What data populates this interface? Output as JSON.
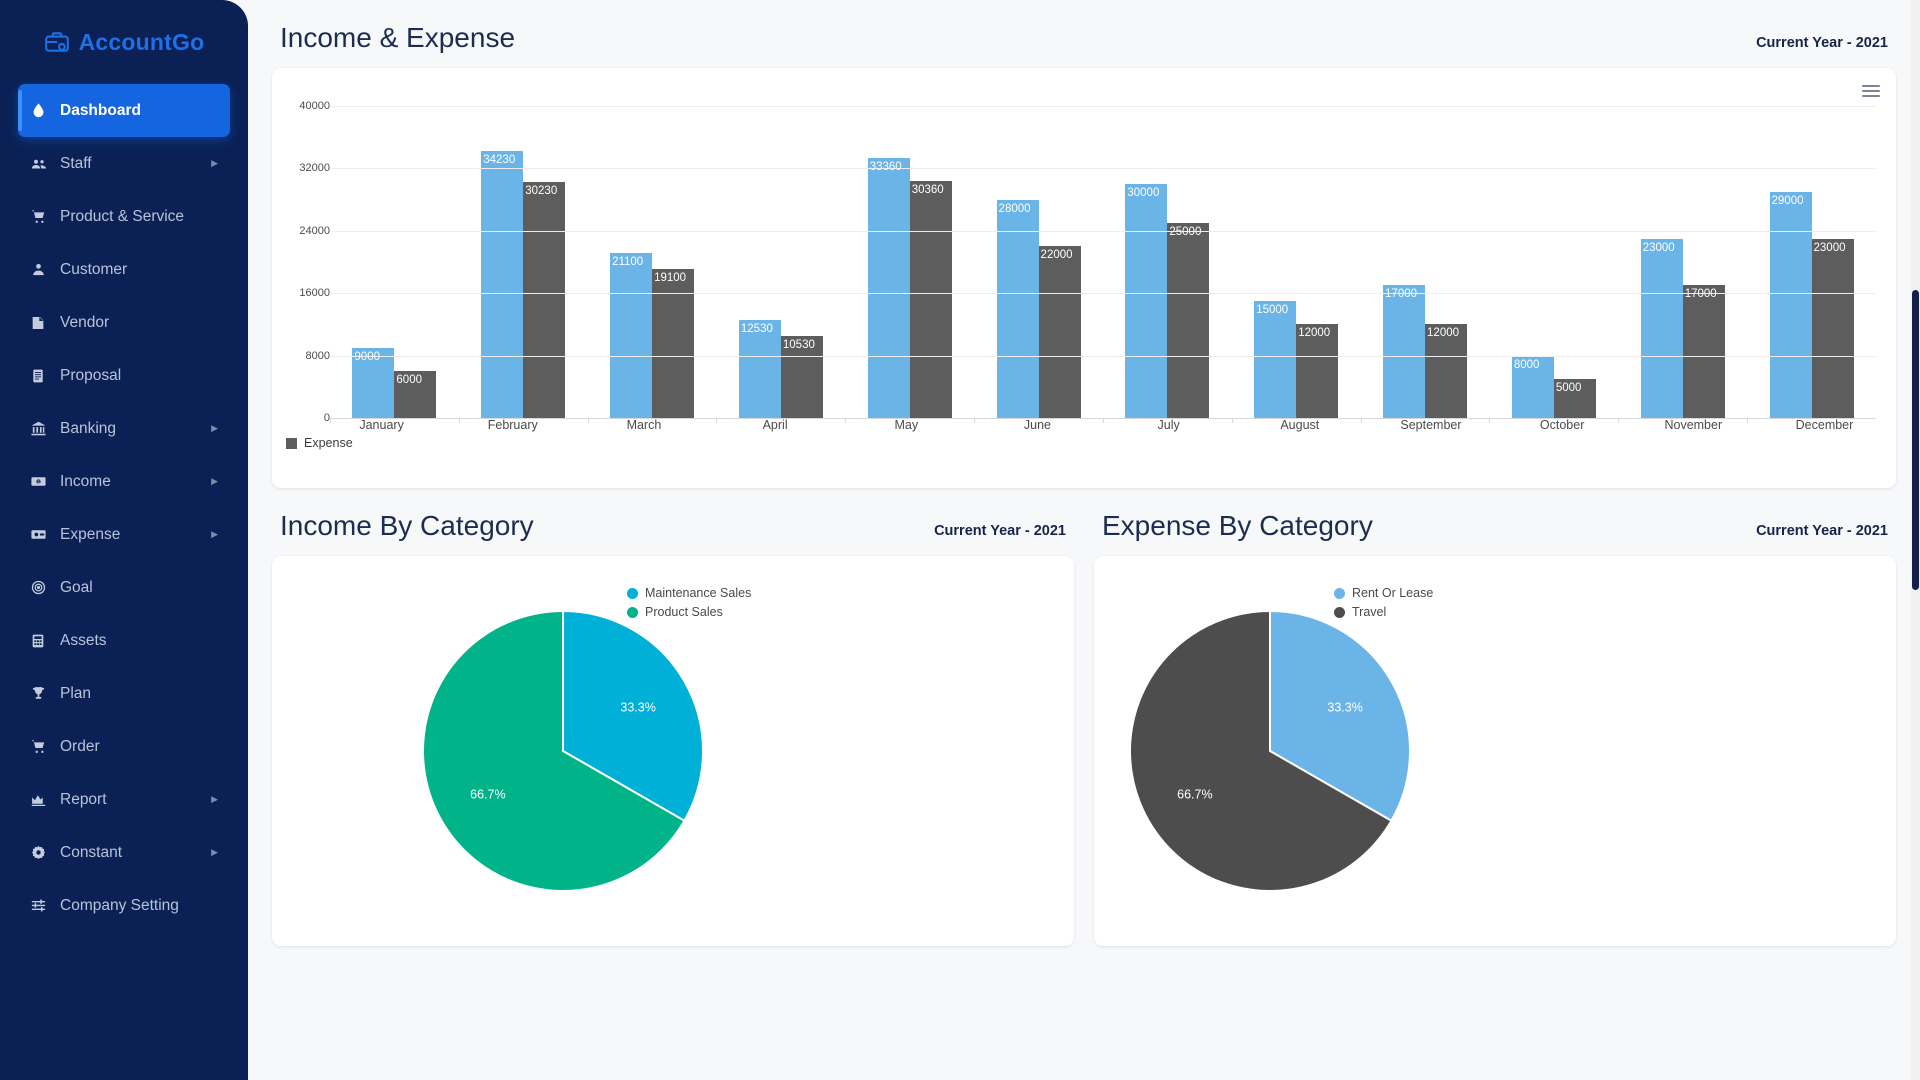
{
  "brand": {
    "name": "AccountGo",
    "logo_icon": "briefcase-logo-icon"
  },
  "sidebar": {
    "items": [
      {
        "label": "Dashboard",
        "icon": "droplet-icon",
        "active": true,
        "arrow": false
      },
      {
        "label": "Staff",
        "icon": "users-icon",
        "active": false,
        "arrow": true
      },
      {
        "label": "Product & Service",
        "icon": "cart-icon",
        "active": false,
        "arrow": false
      },
      {
        "label": "Customer",
        "icon": "user-badge-icon",
        "active": false,
        "arrow": false
      },
      {
        "label": "Vendor",
        "icon": "document-icon",
        "active": false,
        "arrow": false
      },
      {
        "label": "Proposal",
        "icon": "receipt-icon",
        "active": false,
        "arrow": false
      },
      {
        "label": "Banking",
        "icon": "bank-icon",
        "active": false,
        "arrow": true
      },
      {
        "label": "Income",
        "icon": "banknote-icon",
        "active": false,
        "arrow": true
      },
      {
        "label": "Expense",
        "icon": "money-card-icon",
        "active": false,
        "arrow": true
      },
      {
        "label": "Goal",
        "icon": "target-icon",
        "active": false,
        "arrow": false
      },
      {
        "label": "Assets",
        "icon": "calculator-icon",
        "active": false,
        "arrow": false
      },
      {
        "label": "Plan",
        "icon": "trophy-icon",
        "active": false,
        "arrow": false
      },
      {
        "label": "Order",
        "icon": "cart-icon",
        "active": false,
        "arrow": false
      },
      {
        "label": "Report",
        "icon": "chart-icon",
        "active": false,
        "arrow": true
      },
      {
        "label": "Constant",
        "icon": "gear-icon",
        "active": false,
        "arrow": true
      },
      {
        "label": "Company Setting",
        "icon": "sliders-icon",
        "active": false,
        "arrow": false
      }
    ]
  },
  "sections": {
    "income_expense": {
      "title": "Income & Expense",
      "subtitle": "Current Year - 2021",
      "menu_icon": "hamburger-menu-icon"
    },
    "income_category": {
      "title": "Income By Category",
      "subtitle": "Current Year - 2021"
    },
    "expense_category": {
      "title": "Expense By Category",
      "subtitle": "Current Year - 2021"
    }
  },
  "colors": {
    "income_bar": "#6ab4e7",
    "expense_bar": "#5d5d5d",
    "maintenance_sales": "#00b0d7",
    "product_sales": "#00b389",
    "rent_or_lease": "#6ab4e7",
    "travel": "#4d4d4d",
    "sidebar_bg": "#0b2155",
    "accent": "#1565e0"
  },
  "chart_data": [
    {
      "type": "bar",
      "title": "Income & Expense",
      "subtitle": "Current Year - 2021",
      "categories": [
        "January",
        "February",
        "March",
        "April",
        "May",
        "June",
        "July",
        "August",
        "September",
        "October",
        "November",
        "December"
      ],
      "series": [
        {
          "name": "Income",
          "color": "#6ab4e7",
          "values": [
            9000,
            34230,
            21100,
            12530,
            33360,
            28000,
            30000,
            15000,
            17000,
            8000,
            23000,
            29000
          ]
        },
        {
          "name": "Expense",
          "color": "#5d5d5d",
          "values": [
            6000,
            30230,
            19100,
            10530,
            30360,
            22000,
            25000,
            12000,
            12000,
            5000,
            17000,
            23000
          ]
        }
      ],
      "yticks": [
        0,
        8000,
        16000,
        24000,
        32000,
        40000
      ],
      "ylim": [
        0,
        40000
      ],
      "xlabel": "",
      "ylabel": "",
      "grid": true,
      "legend_position": "bottom-left",
      "legend_visible": [
        "Expense"
      ],
      "data_labels": true
    },
    {
      "type": "pie",
      "title": "Income By Category",
      "subtitle": "Current Year - 2021",
      "labels": [
        "Maintenance Sales",
        "Product Sales"
      ],
      "values": [
        33.3,
        66.7
      ],
      "display_values": [
        "33.3%",
        "66.7%"
      ],
      "colors": [
        "#00b0d7",
        "#00b389"
      ],
      "legend_position": "right"
    },
    {
      "type": "pie",
      "title": "Expense By Category",
      "subtitle": "Current Year - 2021",
      "labels": [
        "Rent Or Lease",
        "Travel"
      ],
      "values": [
        33.3,
        66.7
      ],
      "display_values": [
        "33.3%",
        "66.7%"
      ],
      "colors": [
        "#6ab4e7",
        "#4d4d4d"
      ],
      "legend_position": "right"
    }
  ],
  "bar_legend": {
    "label": "Expense"
  }
}
